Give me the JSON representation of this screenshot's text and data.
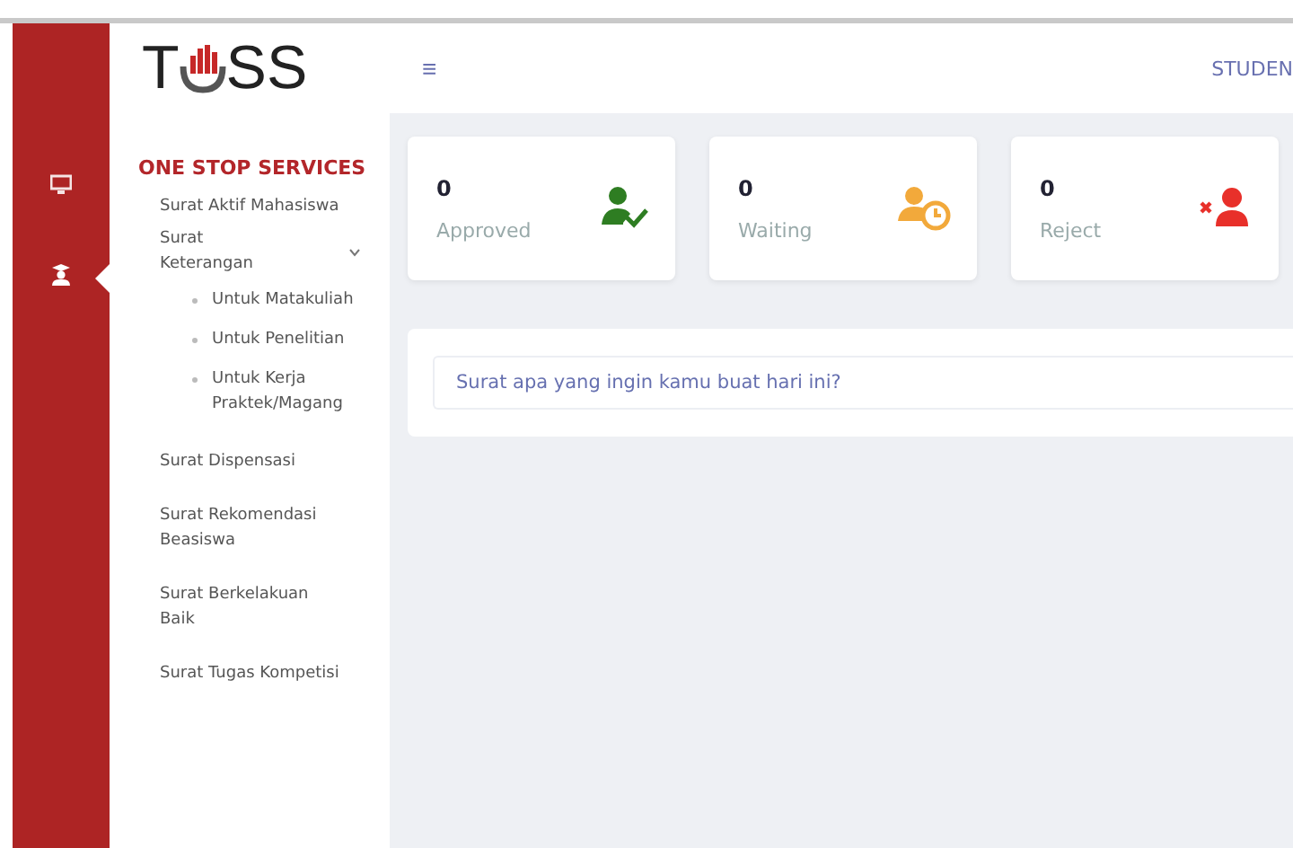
{
  "logo": {
    "left": "T",
    "right": "SS"
  },
  "rail": [
    {
      "kind": "monitor",
      "selected": false
    },
    {
      "kind": "graduate",
      "selected": true
    }
  ],
  "sidebar": {
    "heading": "ONE STOP SERVICES",
    "items": [
      {
        "label": "Surat Aktif Mahasiswa"
      },
      {
        "label": "Surat Keterangan",
        "expanded": true,
        "children": [
          {
            "label": "Untuk Matakuliah"
          },
          {
            "label": "Untuk Penelitian"
          },
          {
            "label": "Untuk Kerja Praktek/Magang"
          }
        ]
      },
      {
        "label": "Surat Dispensasi"
      },
      {
        "label": "Surat Rekomendasi Beasiswa"
      },
      {
        "label": "Surat Berkelakuan Baik"
      },
      {
        "label": "Surat Tugas Kompetisi"
      }
    ]
  },
  "header": {
    "menu": "≡",
    "user": "STUDEN"
  },
  "stats": [
    {
      "value": "0",
      "label": "Approved",
      "kind": "approved",
      "color": "#2e7d22"
    },
    {
      "value": "0",
      "label": "Waiting",
      "kind": "waiting",
      "color": "#f2a93b"
    },
    {
      "value": "0",
      "label": "Reject",
      "kind": "reject",
      "color": "#e8302a"
    }
  ],
  "search": {
    "placeholder": "Surat apa yang ingin kamu buat hari ini?"
  }
}
